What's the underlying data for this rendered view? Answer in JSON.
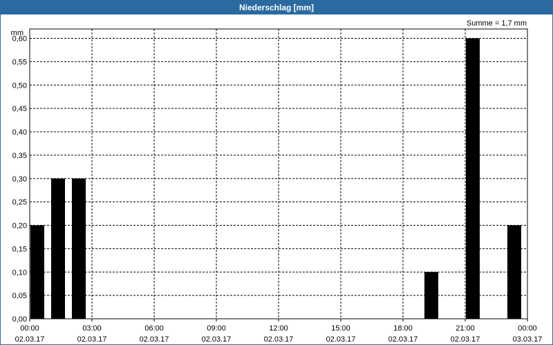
{
  "window": {
    "title": "Niederschlag [mm]"
  },
  "chart_data": {
    "type": "bar",
    "ylabel": "mm",
    "annotation": "Summe = 1,7 mm",
    "ylim": [
      0,
      0.62
    ],
    "yticks": [
      "0,00",
      "0,05",
      "0,10",
      "0,15",
      "0,20",
      "0,25",
      "0,30",
      "0,35",
      "0,40",
      "0,45",
      "0,50",
      "0,55",
      "0,60"
    ],
    "xlim_hours": [
      0,
      24
    ],
    "xticks": [
      {
        "time": "00:00",
        "date": "02.03.17"
      },
      {
        "time": "03:00",
        "date": "02.03.17"
      },
      {
        "time": "06:00",
        "date": "02.03.17"
      },
      {
        "time": "09:00",
        "date": "02.03.17"
      },
      {
        "time": "12:00",
        "date": "02.03.17"
      },
      {
        "time": "15:00",
        "date": "02.03.17"
      },
      {
        "time": "18:00",
        "date": "02.03.17"
      },
      {
        "time": "21:00",
        "date": "02.03.17"
      },
      {
        "time": "00:00",
        "date": "03.03.17"
      }
    ],
    "bars": [
      {
        "hour": 0,
        "value": 0.2
      },
      {
        "hour": 1,
        "value": 0.3
      },
      {
        "hour": 2,
        "value": 0.3
      },
      {
        "hour": 3,
        "value": 0
      },
      {
        "hour": 4,
        "value": 0
      },
      {
        "hour": 5,
        "value": 0
      },
      {
        "hour": 6,
        "value": 0
      },
      {
        "hour": 7,
        "value": 0
      },
      {
        "hour": 8,
        "value": 0
      },
      {
        "hour": 9,
        "value": 0
      },
      {
        "hour": 10,
        "value": 0
      },
      {
        "hour": 11,
        "value": 0
      },
      {
        "hour": 12,
        "value": 0
      },
      {
        "hour": 13,
        "value": 0
      },
      {
        "hour": 14,
        "value": 0
      },
      {
        "hour": 15,
        "value": 0
      },
      {
        "hour": 16,
        "value": 0
      },
      {
        "hour": 17,
        "value": 0
      },
      {
        "hour": 18,
        "value": 0
      },
      {
        "hour": 19,
        "value": 0.1
      },
      {
        "hour": 20,
        "value": 0
      },
      {
        "hour": 21,
        "value": 0.6
      },
      {
        "hour": 22,
        "value": 0
      },
      {
        "hour": 23,
        "value": 0.2
      }
    ],
    "bar_color": "#000000",
    "grid": true
  }
}
